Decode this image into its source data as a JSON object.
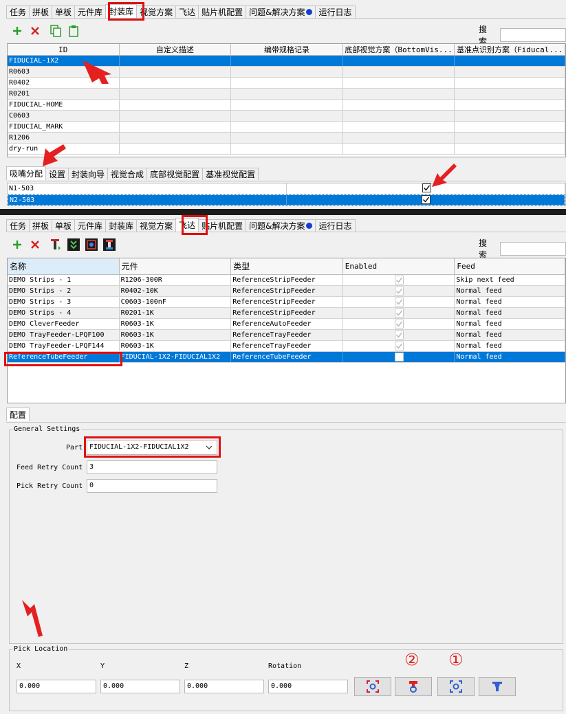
{
  "tabs": [
    "任务",
    "拼板",
    "单板",
    "元件库",
    "封装库",
    "视觉方案",
    "飞达",
    "贴片机配置",
    "问题&解决方案",
    "运行日志"
  ],
  "tabs_bottom": [
    "任务",
    "拼板",
    "单板",
    "元件库",
    "封装库",
    "视觉方案",
    "飞达",
    "贴片机配置",
    "问题&解决方案",
    "运行日志"
  ],
  "search_label": "搜索",
  "packages": {
    "columns": [
      "ID",
      "自定义描述",
      "编带规格记录",
      "底部视觉方案（BottomVis...",
      "基准点识别方案（Fiducal..."
    ],
    "rows": [
      "FIDUCIAL-1X2",
      "R0603",
      "R0402",
      "R0201",
      "FIDUCIAL-HOME",
      "C0603",
      "FIDUCIAL_MARK",
      "R1206",
      "dry-run"
    ]
  },
  "package_subtabs": [
    "吸嘴分配",
    "设置",
    "封装向导",
    "视觉合成",
    "底部视觉配置",
    "基准视觉配置"
  ],
  "nozzles": [
    {
      "name": "N1-503",
      "checked": true
    },
    {
      "name": "N2-503",
      "checked": true
    }
  ],
  "feeders": {
    "columns": [
      "名称",
      "元件",
      "类型",
      "Enabled",
      "Feed"
    ],
    "rows": [
      {
        "name": "DEMO Strips - 1",
        "part": "R1206-300R",
        "type": "ReferenceStripFeeder",
        "enabled": true,
        "feed": "Skip next feed"
      },
      {
        "name": "DEMO Strips - 2",
        "part": "R0402-10K",
        "type": "ReferenceStripFeeder",
        "enabled": true,
        "feed": "Normal feed"
      },
      {
        "name": "DEMO Strips - 3",
        "part": "C0603-100nF",
        "type": "ReferenceStripFeeder",
        "enabled": true,
        "feed": "Normal feed"
      },
      {
        "name": "DEMO Strips - 4",
        "part": "R0201-1K",
        "type": "ReferenceStripFeeder",
        "enabled": true,
        "feed": "Normal feed"
      },
      {
        "name": "DEMO CleverFeeder",
        "part": "R0603-1K",
        "type": "ReferenceAutoFeeder",
        "enabled": true,
        "feed": "Normal feed"
      },
      {
        "name": "DEMO TrayFeeder-LPQF100",
        "part": "R0603-1K",
        "type": "ReferenceTrayFeeder",
        "enabled": true,
        "feed": "Normal feed"
      },
      {
        "name": "DEMO TrayFeeder-LPQF144",
        "part": "R0603-1K",
        "type": "ReferenceTrayFeeder",
        "enabled": true,
        "feed": "Normal feed"
      },
      {
        "name": "ReferenceTubeFeeder",
        "part": "FIDUCIAL-1X2-FIDUCIAL1X2",
        "type": "ReferenceTubeFeeder",
        "enabled": false,
        "feed": "Normal feed"
      }
    ]
  },
  "config_tab": "配置",
  "general": {
    "legend": "General Settings",
    "part_label": "Part",
    "part_value": "FIDUCIAL-1X2-FIDUCIAL1X2",
    "retry_label": "Feed Retry Count",
    "retry_value": "3",
    "pick_retry_label": "Pick Retry Count",
    "pick_retry_value": "0"
  },
  "pick": {
    "legend": "Pick Location",
    "x_label": "X",
    "y_label": "Y",
    "z_label": "Z",
    "rot_label": "Rotation",
    "x": "0.000",
    "y": "0.000",
    "z": "0.000",
    "rot": "0.000"
  },
  "annotations": {
    "one": "①",
    "two": "②"
  },
  "colors": {
    "selection": "#0078d7",
    "highlight": "#e01010"
  }
}
